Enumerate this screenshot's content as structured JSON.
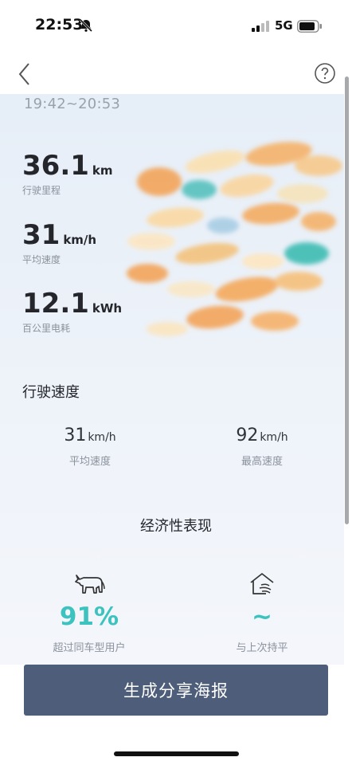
{
  "status_bar": {
    "time": "22:53",
    "network": "5G"
  },
  "trip": {
    "time_range": "19:42~20:53",
    "stats": [
      {
        "value": "36.1",
        "unit": "km",
        "label": "行驶里程"
      },
      {
        "value": "31",
        "unit": "km/h",
        "label": "平均速度"
      },
      {
        "value": "12.1",
        "unit": "kWh",
        "label": "百公里电耗"
      }
    ]
  },
  "speed_section": {
    "title": "行驶速度",
    "avg": {
      "value": "31",
      "unit": "km/h",
      "label": "平均速度"
    },
    "max": {
      "value": "92",
      "unit": "km/h",
      "label": "最高速度"
    }
  },
  "economy": {
    "title": "经济性表现",
    "left": {
      "icon": "bull-icon",
      "value": "91%",
      "label": "超过同车型用户"
    },
    "right": {
      "icon": "house-wind-icon",
      "value": "~",
      "label": "与上次持平"
    }
  },
  "cta": {
    "label": "生成分享海报"
  },
  "colors": {
    "accent": "#3cc3c0",
    "button": "#4e5d79"
  }
}
